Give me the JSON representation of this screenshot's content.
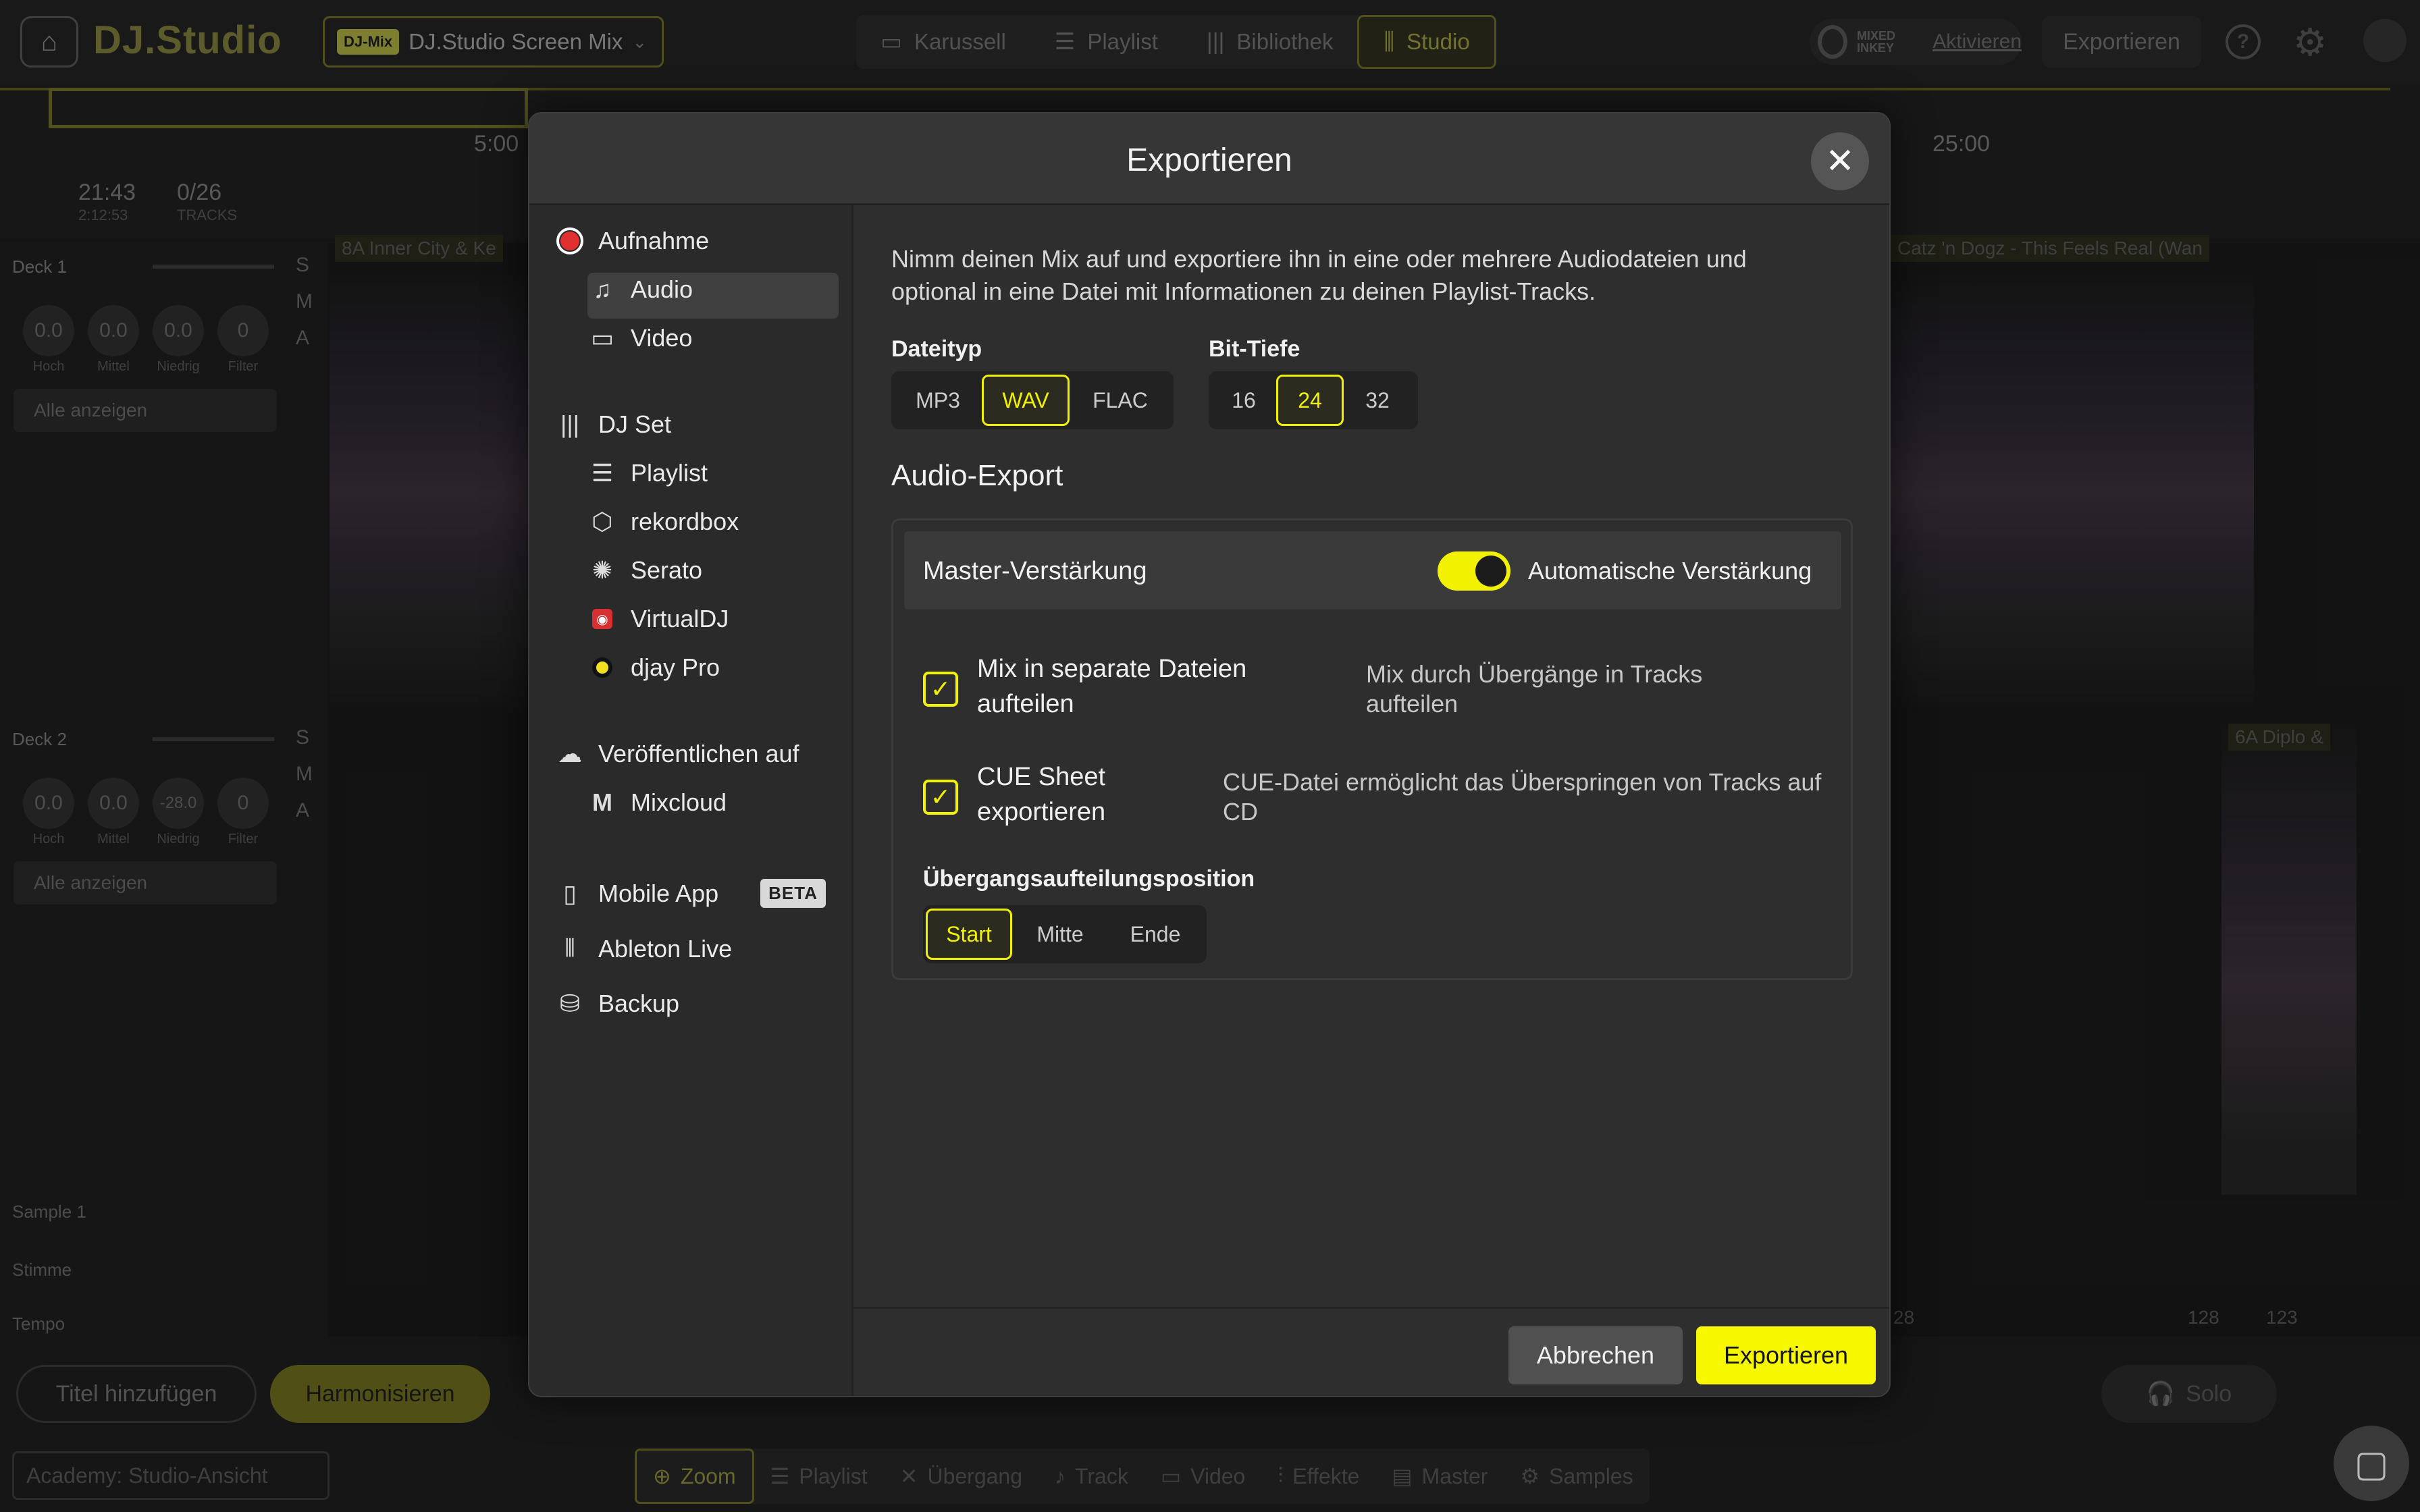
{
  "app": {
    "logo": "DJ.Studio",
    "mix_badge": "DJ-Mix",
    "mix_name": "DJ.Studio Screen Mix",
    "nav_tabs": [
      {
        "label": "Karussell",
        "icon": "carousel-icon"
      },
      {
        "label": "Playlist",
        "icon": "playlist-icon"
      },
      {
        "label": "Bibliothek",
        "icon": "library-icon"
      },
      {
        "label": "Studio",
        "icon": "waveform-icon",
        "active": true
      }
    ],
    "mixedinkey_logo": "MIXED INKEY",
    "activate_link": "Aktivieren",
    "export_button": "Exportieren",
    "time_elapsed": "21:43",
    "time_total": "2:12:53",
    "tracks_count": "0/26",
    "tracks_label": "TRACKS",
    "timeline_marks": [
      "5:00",
      "25:00"
    ],
    "deck1": {
      "label": "Deck 1",
      "knobs": [
        "0.0",
        "0.0",
        "0.0",
        "0"
      ],
      "knob_labels": [
        "Hoch",
        "Mittel",
        "Niedrig",
        "Filter"
      ],
      "show_all": "Alle anzeigen"
    },
    "deck2": {
      "label": "Deck 2",
      "knobs": [
        "0.0",
        "0.0",
        "-28.0",
        "0"
      ],
      "knob_labels": [
        "Hoch",
        "Mittel",
        "Niedrig",
        "Filter"
      ],
      "show_all": "Alle anzeigen"
    },
    "rows": [
      "Sample 1",
      "Stimme",
      "Tempo"
    ],
    "track_tags": [
      "8A Inner City & Ke",
      "Catz 'n Dogz - This Feels Real (Wan",
      "6A Diplo &"
    ],
    "bpm_marks": [
      "28",
      "128",
      "123"
    ],
    "bottom": {
      "add_title": "Titel hinzufügen",
      "harmonize": "Harmonisieren",
      "solo": "Solo",
      "academy": "Academy: Studio-Ansicht",
      "tabs": [
        "Zoom",
        "Playlist",
        "Übergang",
        "Track",
        "Video",
        "Effekte",
        "Master",
        "Samples"
      ]
    }
  },
  "modal": {
    "title": "Exportieren",
    "sidebar": {
      "recording": "Aufnahme",
      "audio": "Audio",
      "video": "Video",
      "dj_set": "DJ Set",
      "playlist": "Playlist",
      "rekordbox": "rekordbox",
      "serato": "Serato",
      "virtualdj": "VirtualDJ",
      "djay": "djay Pro",
      "publish": "Veröffentlichen auf",
      "mixcloud": "Mixcloud",
      "mobile": "Mobile App",
      "beta": "BETA",
      "ableton": "Ableton Live",
      "backup": "Backup"
    },
    "intro": "Nimm deinen Mix auf und exportiere ihn in eine oder mehrere Audiodateien und optional in eine Datei mit Informationen zu deinen Playlist-Tracks.",
    "filetype_label": "Dateityp",
    "filetypes": [
      "MP3",
      "WAV",
      "FLAC"
    ],
    "filetype_selected": "WAV",
    "bitdepth_label": "Bit-Tiefe",
    "bitdepths": [
      "16",
      "24",
      "32"
    ],
    "bitdepth_selected": "24",
    "audio_export_title": "Audio-Export",
    "master_gain": "Master-Verstärkung",
    "auto_gain": "Automatische Verstärkung",
    "split_label": "Mix in separate Dateien aufteilen",
    "split_desc": "Mix durch Übergänge in Tracks aufteilen",
    "cue_label": "CUE Sheet exportieren",
    "cue_desc": "CUE-Datei ermöglicht das Überspringen von Tracks auf CD",
    "split_pos_label": "Übergangsaufteilungsposition",
    "split_positions": [
      "Start",
      "Mitte",
      "Ende"
    ],
    "split_pos_selected": "Start",
    "cancel": "Abbrechen",
    "export": "Exportieren"
  }
}
